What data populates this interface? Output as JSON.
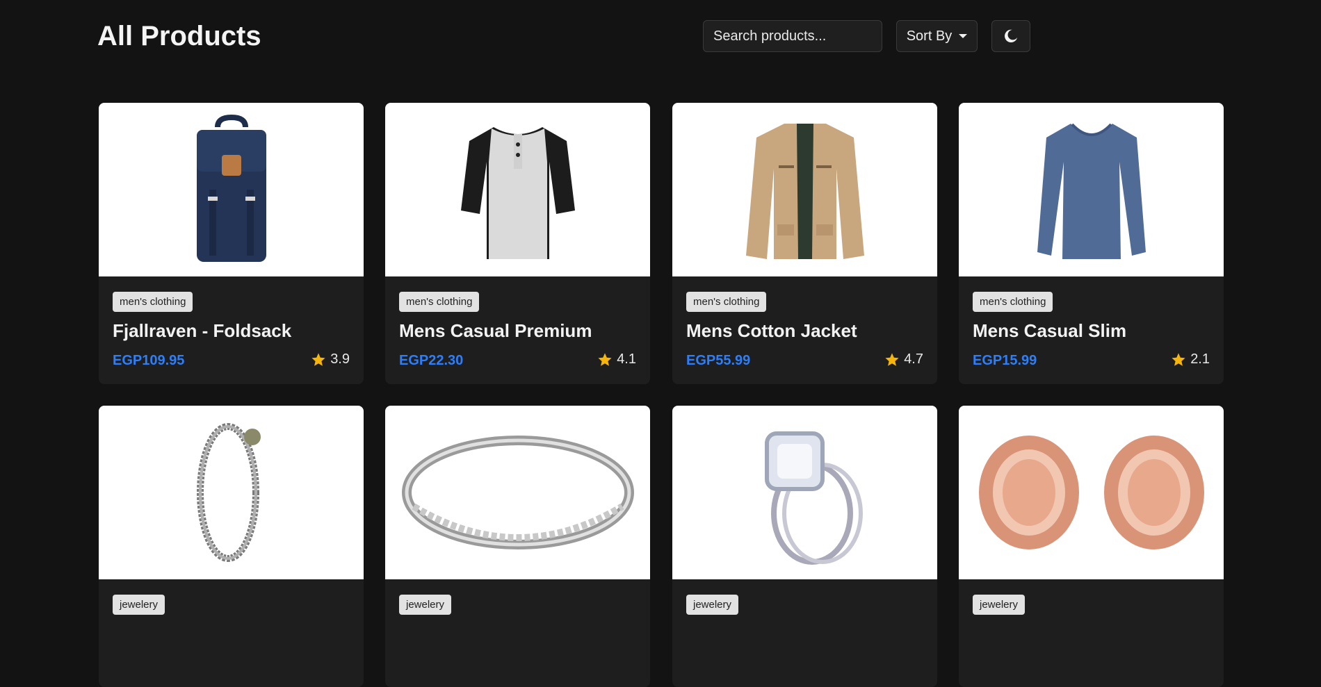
{
  "header": {
    "title": "All Products",
    "search_placeholder": "Search products...",
    "sort_label": "Sort By",
    "theme_icon": "moon-icon"
  },
  "colors": {
    "background": "#131313",
    "card": "#1e1e1e",
    "price": "#2d7ff9",
    "star": "#f5b50a",
    "badge": "#e2e2e2"
  },
  "products": [
    {
      "category": "men's clothing",
      "name": "Fjallraven - Foldsack",
      "price": "EGP109.95",
      "rating": "3.9",
      "image": "backpack"
    },
    {
      "category": "men's clothing",
      "name": "Mens Casual Premium",
      "price": "EGP22.30",
      "rating": "4.1",
      "image": "henley-shirt"
    },
    {
      "category": "men's clothing",
      "name": "Mens Cotton Jacket",
      "price": "EGP55.99",
      "rating": "4.7",
      "image": "jacket"
    },
    {
      "category": "men's clothing",
      "name": "Mens Casual Slim",
      "price": "EGP15.99",
      "rating": "2.1",
      "image": "long-sleeve-shirt"
    },
    {
      "category": "jewelery",
      "image": "chain-bracelet"
    },
    {
      "category": "jewelery",
      "image": "silver-ring"
    },
    {
      "category": "jewelery",
      "image": "diamond-ring"
    },
    {
      "category": "jewelery",
      "image": "rose-gold-plugs"
    }
  ]
}
